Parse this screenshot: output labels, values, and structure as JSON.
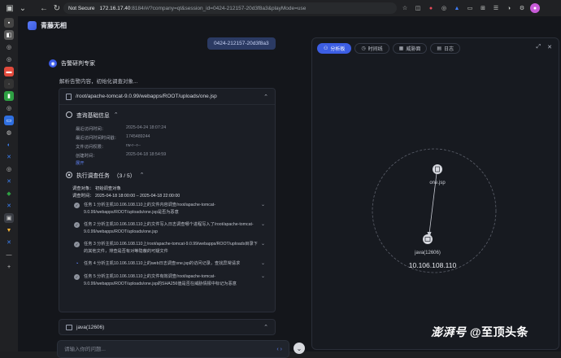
{
  "browser": {
    "not_secure": "Not Secure",
    "url_host": "172.16.17.40",
    "url_path": ":8184/#/?company=qt&session_id=0424-212157-20d3f8a3&playMode=use"
  },
  "app": {
    "title": "青藤无相"
  },
  "session": {
    "id": "0424-212157-20d3f8a3"
  },
  "agent": {
    "name": "告警研判专家",
    "status": "解析告警内容，初始化调查对象..."
  },
  "card": {
    "path": "/root/apache-tomcat-9.0.99/webapps/ROOT/uploads/one.jsp",
    "query_section": "查询基础信息",
    "fields": [
      {
        "k": "最近访问时间：",
        "v": "2025-04-24 18:07:24"
      },
      {
        "k": "最近访问时间时间戳：",
        "v": "1745489244"
      },
      {
        "k": "文件访问权限：",
        "v": "rw-r--r--"
      },
      {
        "k": "创建时间：",
        "v": "2025-04-18 18:54:59"
      }
    ],
    "expand": "展开",
    "task_section": "执行调查任务",
    "task_progress": "（3 / 5）",
    "object_line": "调查对象：  初始调查对象",
    "window_line": "调查时间：  2025-04-18 18:00:00 – 2025-04-18 22:00:00",
    "tasks": [
      {
        "state": "done",
        "text": "任务 1 分析主机10.106.108.110上的文件内容调查/root/apache-tomcat-9.0.99/webapps/ROOT/uploads/one.jsp是否为恶意"
      },
      {
        "state": "done",
        "text": "任务 2 分析主机10.106.108.110上的文件写入日志调查哪个进程写入了/root/apache-tomcat-9.0.99/webapps/ROOT/uploads/one.jsp"
      },
      {
        "state": "done",
        "text": "任务 3 分析主机10.106.108.110上/root/apache-tomcat-9.0.99/webapps/ROOT/uploads目录下的其他文件，排查是否有对等隐蔽的可疑文件"
      },
      {
        "state": "running",
        "text": "任务 4 分析主机10.106.108.110上的web日志调查one.jsp的访问记录，查找异常请求"
      },
      {
        "state": "done",
        "text": "任务 5 分析主机10.106.108.110上的文件有效调查/root/apache-tomcat-9.0.99/webapps/ROOT/uploads/one.jsp的SHA256值是否在威胁情报中标记为恶意"
      }
    ]
  },
  "card2": {
    "title": "java(12606)"
  },
  "input": {
    "placeholder": "请输入你的问题..."
  },
  "panel": {
    "tabs": [
      {
        "label": "分析板",
        "active": true
      },
      {
        "label": "时间线",
        "active": false
      },
      {
        "label": "威胁面",
        "active": false
      },
      {
        "label": "日志",
        "active": false
      }
    ],
    "nodes": {
      "file": "one.jsp",
      "proc": "java(12606)",
      "host": "10.106.108.110"
    }
  },
  "watermark": {
    "brand": "澎湃号",
    "suffix": "@至顶头条"
  },
  "colors": {
    "accent": "#3c5ee4",
    "background": "#14161b"
  }
}
